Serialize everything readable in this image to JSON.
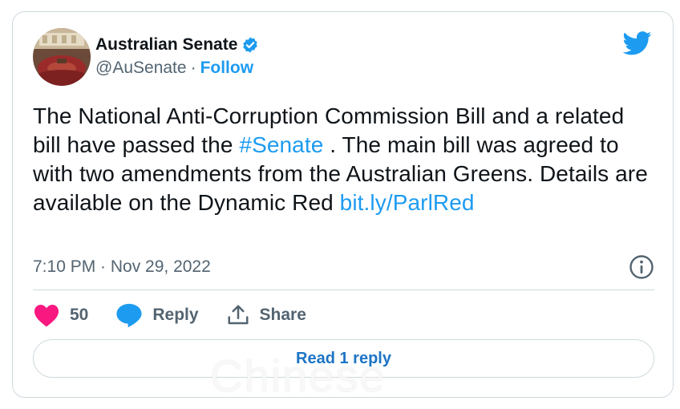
{
  "tweet": {
    "author": {
      "display_name": "Australian Senate",
      "handle": "@AuSenate",
      "separator": "·",
      "follow_label": "Follow",
      "verified": true
    },
    "text_segments": [
      "The National Anti-Corruption Commission Bill and a related bill have passed the ",
      " . The main bill was agreed to with two amendments from the Australian Greens. Details are available on the Dynamic Red "
    ],
    "hashtag": "#Senate",
    "link": "bit.ly/ParlRed",
    "timestamp": "7:10 PM · Nov 29, 2022",
    "likes_count": "50",
    "reply_label": "Reply",
    "share_label": "Share",
    "read_replies_label": "Read 1 reply"
  },
  "icons": {
    "brand": "twitter-bird-icon",
    "verified": "verified-badge-icon",
    "info": "info-icon",
    "like": "heart-icon",
    "reply": "speech-bubble-icon",
    "share": "share-upload-icon"
  },
  "colors": {
    "accent": "#1d9bf0",
    "heart": "#f91880",
    "muted_text": "#536471",
    "border": "#cfd9de",
    "text": "#0f1419"
  },
  "watermark": "Chinese"
}
